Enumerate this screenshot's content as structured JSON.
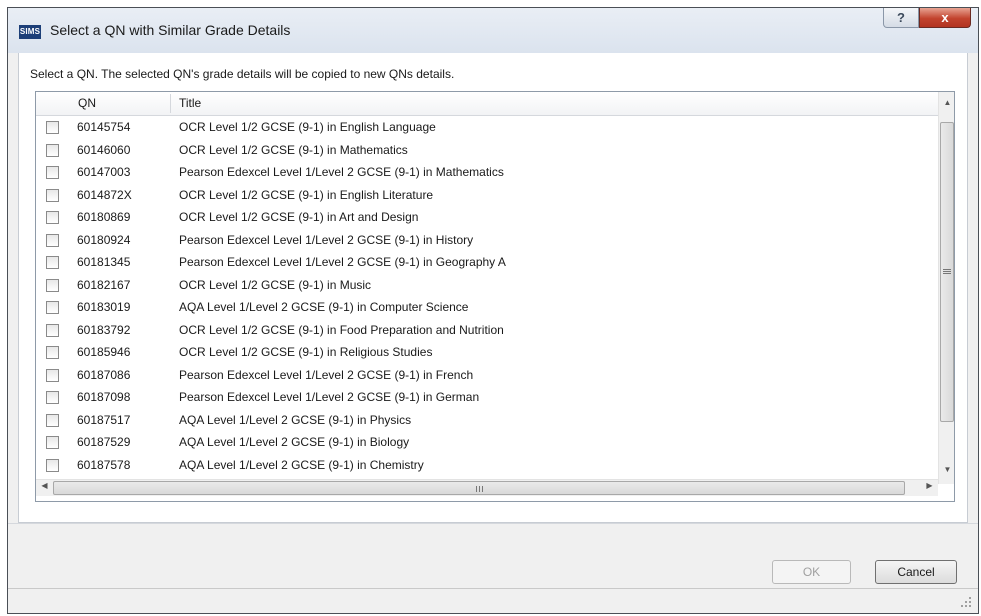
{
  "window": {
    "app_icon": "SIMS",
    "title": "Select a QN with Similar Grade Details",
    "help_label": "?",
    "close_label": "x"
  },
  "instruction": "Select a QN. The selected QN's grade details will be copied to new QNs details.",
  "grid": {
    "columns": [
      "QN",
      "Title"
    ],
    "rows": [
      {
        "qn": "60145754",
        "title": "OCR Level 1/2 GCSE (9-1) in English Language"
      },
      {
        "qn": "60146060",
        "title": "OCR Level 1/2 GCSE (9-1) in Mathematics"
      },
      {
        "qn": "60147003",
        "title": "Pearson Edexcel Level 1/Level 2 GCSE (9-1) in Mathematics"
      },
      {
        "qn": "6014872X",
        "title": "OCR Level 1/2 GCSE (9-1) in English Literature"
      },
      {
        "qn": "60180869",
        "title": "OCR Level 1/2 GCSE (9-1) in Art and Design"
      },
      {
        "qn": "60180924",
        "title": "Pearson Edexcel Level 1/Level 2 GCSE (9-1) in History"
      },
      {
        "qn": "60181345",
        "title": "Pearson Edexcel Level 1/Level 2 GCSE (9-1) in Geography A"
      },
      {
        "qn": "60182167",
        "title": "OCR Level 1/2 GCSE (9-1) in Music"
      },
      {
        "qn": "60183019",
        "title": "AQA Level 1/Level 2 GCSE (9-1) in Computer Science"
      },
      {
        "qn": "60183792",
        "title": "OCR Level 1/2 GCSE (9-1) in Food Preparation and Nutrition"
      },
      {
        "qn": "60185946",
        "title": "OCR Level 1/2 GCSE (9-1) in Religious Studies"
      },
      {
        "qn": "60187086",
        "title": "Pearson Edexcel Level 1/Level 2 GCSE (9-1) in French"
      },
      {
        "qn": "60187098",
        "title": "Pearson Edexcel Level 1/Level 2 GCSE (9-1) in German"
      },
      {
        "qn": "60187517",
        "title": "AQA Level 1/Level 2 GCSE (9-1) in Physics"
      },
      {
        "qn": "60187529",
        "title": "AQA Level 1/Level 2 GCSE (9-1) in Biology"
      },
      {
        "qn": "60187578",
        "title": "AQA Level 1/Level 2 GCSE (9-1) in Chemistry"
      }
    ]
  },
  "buttons": {
    "ok": "OK",
    "cancel": "Cancel"
  },
  "icons": {
    "up": "▲",
    "down": "▼",
    "left": "◀",
    "right": "▶"
  },
  "colors": {
    "app_icon_bg": "#1d3f78",
    "close_button": "#c2432e"
  }
}
